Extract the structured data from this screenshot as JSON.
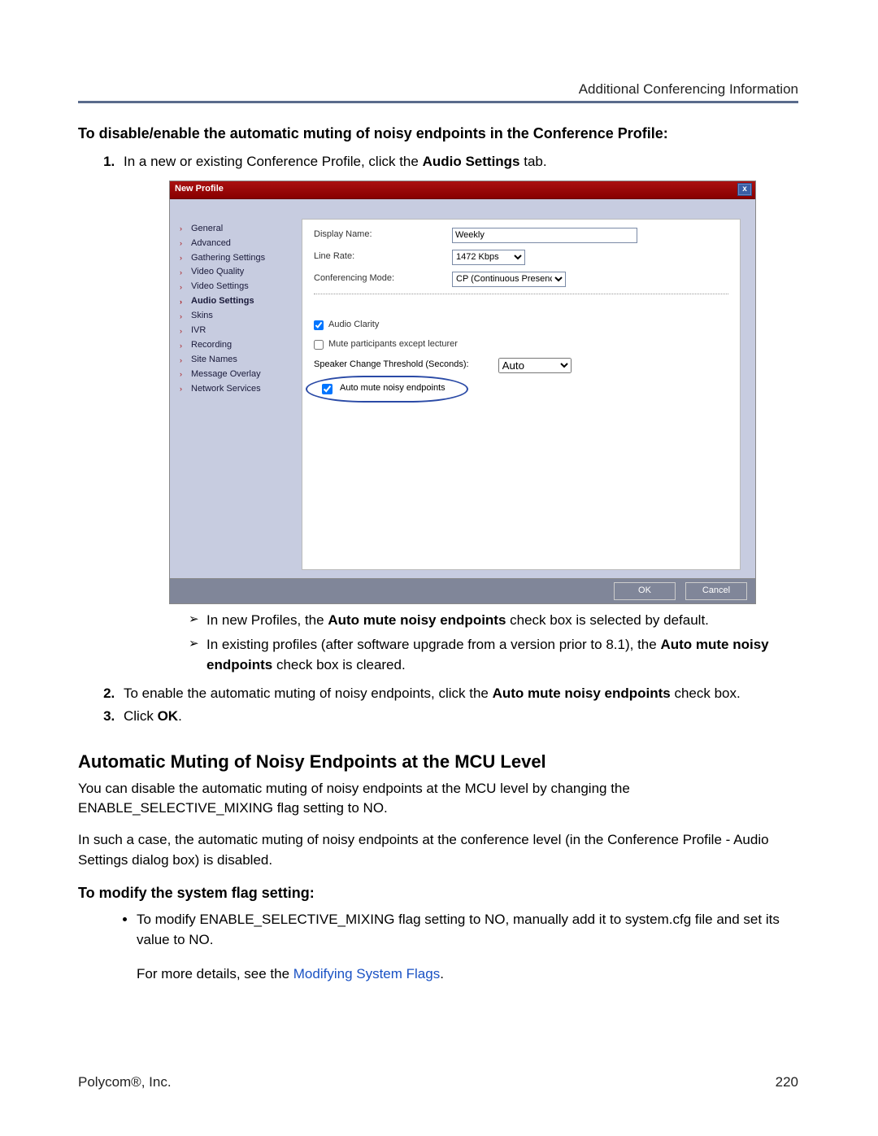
{
  "header": {
    "right": "Additional Conferencing Information"
  },
  "heading1": "To disable/enable the automatic muting of noisy endpoints in the Conference Profile:",
  "step1_a": "In a new or existing Conference Profile, click the ",
  "step1_b": "Audio Settings",
  "step1_c": " tab.",
  "dialog": {
    "title": "New Profile",
    "close": "x",
    "nav": {
      "n0": "General",
      "n1": "Advanced",
      "n2": "Gathering Settings",
      "n3": "Video Quality",
      "n4": "Video Settings",
      "n5": "Audio Settings",
      "n6": "Skins",
      "n7": "IVR",
      "n8": "Recording",
      "n9": "Site Names",
      "n10": "Message Overlay",
      "n11": "Network Services"
    },
    "form": {
      "display_label": "Display Name:",
      "display_value": "Weekly",
      "rate_label": "Line Rate:",
      "rate_value": "1472 Kbps",
      "mode_label": "Conferencing Mode:",
      "mode_value": "CP (Continuous Presence)",
      "clarity": "Audio Clarity",
      "mute_lect": "Mute participants except lecturer",
      "speaker_label": "Speaker Change Threshold (Seconds):",
      "speaker_value": "Auto",
      "auto_mute": "Auto mute noisy endpoints"
    },
    "ok": "OK",
    "cancel": "Cancel"
  },
  "arrow1_a": "In new Profiles, the ",
  "arrow1_b": "Auto mute noisy endpoints",
  "arrow1_c": " check box is selected by default.",
  "arrow2_a": "In existing profiles (after software upgrade from a version prior to 8.1), the ",
  "arrow2_b": "Auto mute noisy endpoints",
  "arrow2_c": " check box is cleared.",
  "step2_a": "To enable the automatic muting of noisy endpoints, click the ",
  "step2_b": "Auto mute noisy endpoints",
  "step2_c": " check box.",
  "step3_a": "Click ",
  "step3_b": "OK",
  "step3_c": ".",
  "h2": "Automatic Muting of Noisy Endpoints at the MCU Level",
  "p1": "You can disable the automatic muting of noisy endpoints at the MCU level by changing the ENABLE_SELECTIVE_MIXING flag setting to NO.",
  "p2": "In such a case, the automatic muting of noisy endpoints at the conference level (in the Conference Profile - Audio Settings dialog box) is disabled.",
  "h3": "To modify the system flag setting:",
  "dot1": "To modify ENABLE_SELECTIVE_MIXING flag setting to NO, manually add it to system.cfg file and set its value to NO.",
  "more_a": "For more details, see the ",
  "more_link": "Modifying System Flags",
  "more_b": ".",
  "footer": {
    "left": "Polycom®, Inc.",
    "right": "220"
  }
}
